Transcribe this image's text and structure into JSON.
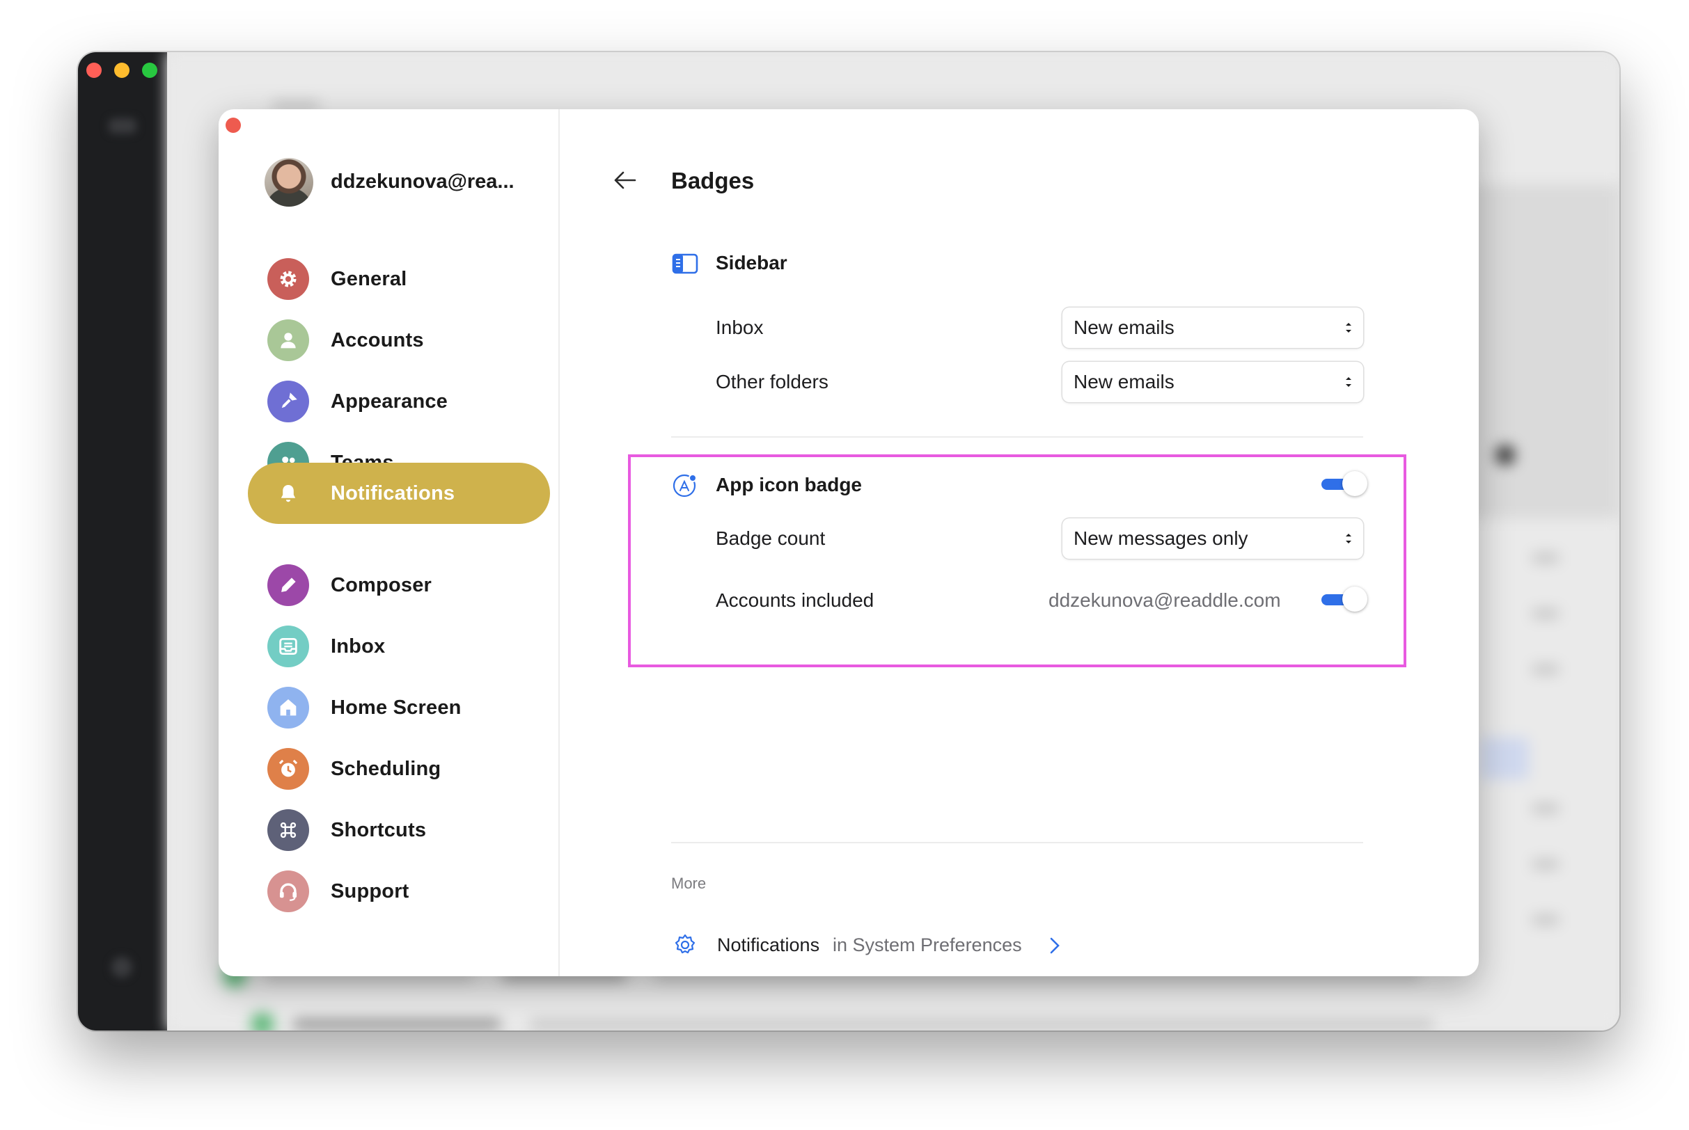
{
  "sidebar": {
    "account": "ddzekunova@rea...",
    "items": [
      {
        "label": "General"
      },
      {
        "label": "Accounts"
      },
      {
        "label": "Appearance"
      },
      {
        "label": "Teams"
      },
      {
        "label": "Notifications"
      },
      {
        "label": "Composer"
      },
      {
        "label": "Inbox"
      },
      {
        "label": "Home Screen"
      },
      {
        "label": "Scheduling"
      },
      {
        "label": "Shortcuts"
      },
      {
        "label": "Support"
      }
    ],
    "active_color": "#cfb24c"
  },
  "main": {
    "title": "Badges",
    "sidebar_section": {
      "title": "Sidebar",
      "rows": [
        {
          "label": "Inbox",
          "value": "New emails"
        },
        {
          "label": "Other folders",
          "value": "New emails"
        }
      ]
    },
    "app_icon_section": {
      "title": "App icon badge",
      "enabled": true,
      "badge_count": {
        "label": "Badge count",
        "value": "New messages only"
      },
      "accounts_included": {
        "label": "Accounts included",
        "email": "ddzekunova@readdle.com",
        "enabled": true
      }
    },
    "more": {
      "label": "More",
      "link_label": "Notifications",
      "link_hint": "in System Preferences"
    }
  },
  "colors": {
    "accent": "#2f6fe8",
    "highlight": "#e85ae0"
  }
}
